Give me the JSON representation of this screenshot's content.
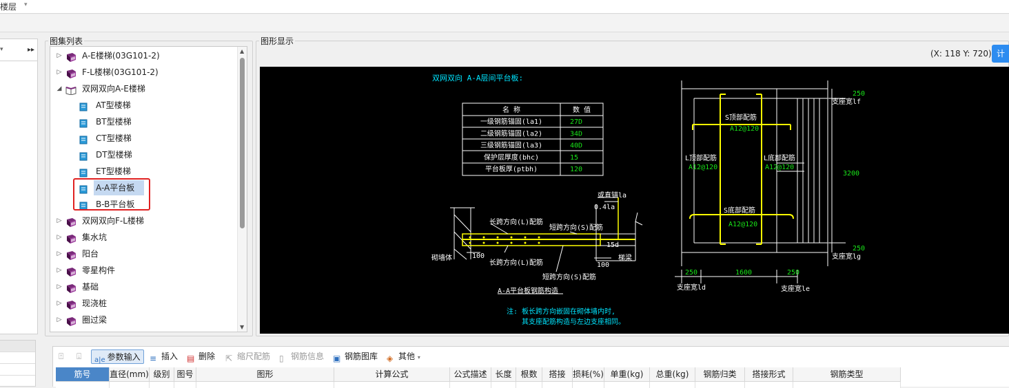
{
  "top": {
    "floor_label": "楼层",
    "caret": "▾"
  },
  "tree_group": {
    "title": "图集列表"
  },
  "display_group": {
    "title": "图形显示"
  },
  "tree": {
    "items": [
      {
        "label": "A-E楼梯(03G101-2)",
        "level": 0,
        "expand": "▷",
        "icon": "closed-book-icon"
      },
      {
        "label": "F-L楼梯(03G101-2)",
        "level": 0,
        "expand": "▷",
        "icon": "closed-book-icon"
      },
      {
        "label": "双网双向A-E楼梯",
        "level": 0,
        "expand": "◢",
        "icon": "open-book-icon"
      },
      {
        "label": "AT型楼梯",
        "level": 1,
        "expand": "",
        "icon": "page-icon"
      },
      {
        "label": "BT型楼梯",
        "level": 1,
        "expand": "",
        "icon": "page-icon"
      },
      {
        "label": "CT型楼梯",
        "level": 1,
        "expand": "",
        "icon": "page-icon"
      },
      {
        "label": "DT型楼梯",
        "level": 1,
        "expand": "",
        "icon": "page-icon"
      },
      {
        "label": "ET型楼梯",
        "level": 1,
        "expand": "",
        "icon": "page-icon"
      },
      {
        "label": "A-A平台板",
        "level": 1,
        "expand": "",
        "icon": "page-icon",
        "selected": true
      },
      {
        "label": "B-B平台板",
        "level": 1,
        "expand": "",
        "icon": "page-icon"
      },
      {
        "label": "双网双向F-L楼梯",
        "level": 0,
        "expand": "▷",
        "icon": "closed-book-icon"
      },
      {
        "label": "集水坑",
        "level": 0,
        "expand": "▷",
        "icon": "closed-book-icon"
      },
      {
        "label": "阳台",
        "level": 0,
        "expand": "▷",
        "icon": "closed-book-icon"
      },
      {
        "label": "零星构件",
        "level": 0,
        "expand": "▷",
        "icon": "closed-book-icon"
      },
      {
        "label": "基础",
        "level": 0,
        "expand": "▷",
        "icon": "closed-book-icon"
      },
      {
        "label": "现浇桩",
        "level": 0,
        "expand": "▷",
        "icon": "closed-book-icon"
      },
      {
        "label": "圈过梁",
        "level": 0,
        "expand": "▷",
        "icon": "closed-book-icon"
      }
    ]
  },
  "coords": "(X: 118 Y: 720)",
  "calc_button": "计",
  "drawing": {
    "title": "双网双向 A-A层间平台板:",
    "table_headers": [
      "名  称",
      "数  值"
    ],
    "table_rows": [
      {
        "name": "一级钢筋锚固(la1)",
        "value": "27D"
      },
      {
        "name": "二级钢筋锚固(la2)",
        "value": "34D"
      },
      {
        "name": "三级钢筋锚固(la3)",
        "value": "40D"
      },
      {
        "name": "保护层厚度(bhc)",
        "value": "15"
      },
      {
        "name": "平台板厚(ptbh)",
        "value": "120"
      }
    ],
    "section": {
      "straight_anchor": "或直锚la",
      "anchor_04": "0.4la",
      "long_top": "长跨方向(L)配筋",
      "short_top": "短跨方向(S)配筋",
      "d15": "15d",
      "wall": "砌墙体",
      "dim100a": "100",
      "long_bottom": "长跨方向(L)配筋",
      "dim100b": "100",
      "stair_beam": "梯梁",
      "short_bottom": "短跨方向(S)配筋",
      "caption": "A-A平台板钢筋构造",
      "note1": "注: 板长跨方向嵌固在砌体墙内时,",
      "note2": "其支座配筋构造与左边支座相同。"
    },
    "plan": {
      "dim_top": "250",
      "support_f": "支座宽lf",
      "s_top": "S顶部配筋",
      "s_top_val": "A12@120",
      "l_top": "L顶部配筋",
      "l_top_val": "A12@120",
      "l_bottom": "L底部配筋",
      "l_bottom_val": "A12@120",
      "dim_3200": "3200",
      "s_bottom": "S底部配筋",
      "s_bottom_val": "A12@120",
      "dim_bot": "250",
      "support_g": "支座宽lg",
      "dim_250a": "250",
      "dim_1600": "1600",
      "dim_250b": "250",
      "support_d": "支座宽ld",
      "support_e": "支座宽le"
    }
  },
  "toolbar": {
    "param_input": "参数输入",
    "insert": "插入",
    "delete": "删除",
    "scale_rebar": "缩尺配筋",
    "rebar_info": "钢筋信息",
    "rebar_lib": "钢筋图库",
    "other": "其他"
  },
  "grid_headers": [
    "筋号",
    "直径(mm)",
    "级别",
    "图号",
    "图形",
    "计算公式",
    "公式描述",
    "长度",
    "根数",
    "搭接",
    "损耗(%)",
    "单重(kg)",
    "总重(kg)",
    "钢筋归类",
    "搭接形式",
    "钢筋类型"
  ],
  "colors": {
    "cad_cyan": "#00e5ff",
    "cad_green": "#19e619",
    "cad_yellow": "#ffff00",
    "cad_white": "#ffffff",
    "selection": "#c5d9f1",
    "highlight_box": "#e02020",
    "header_blue": "#4a86c8"
  }
}
